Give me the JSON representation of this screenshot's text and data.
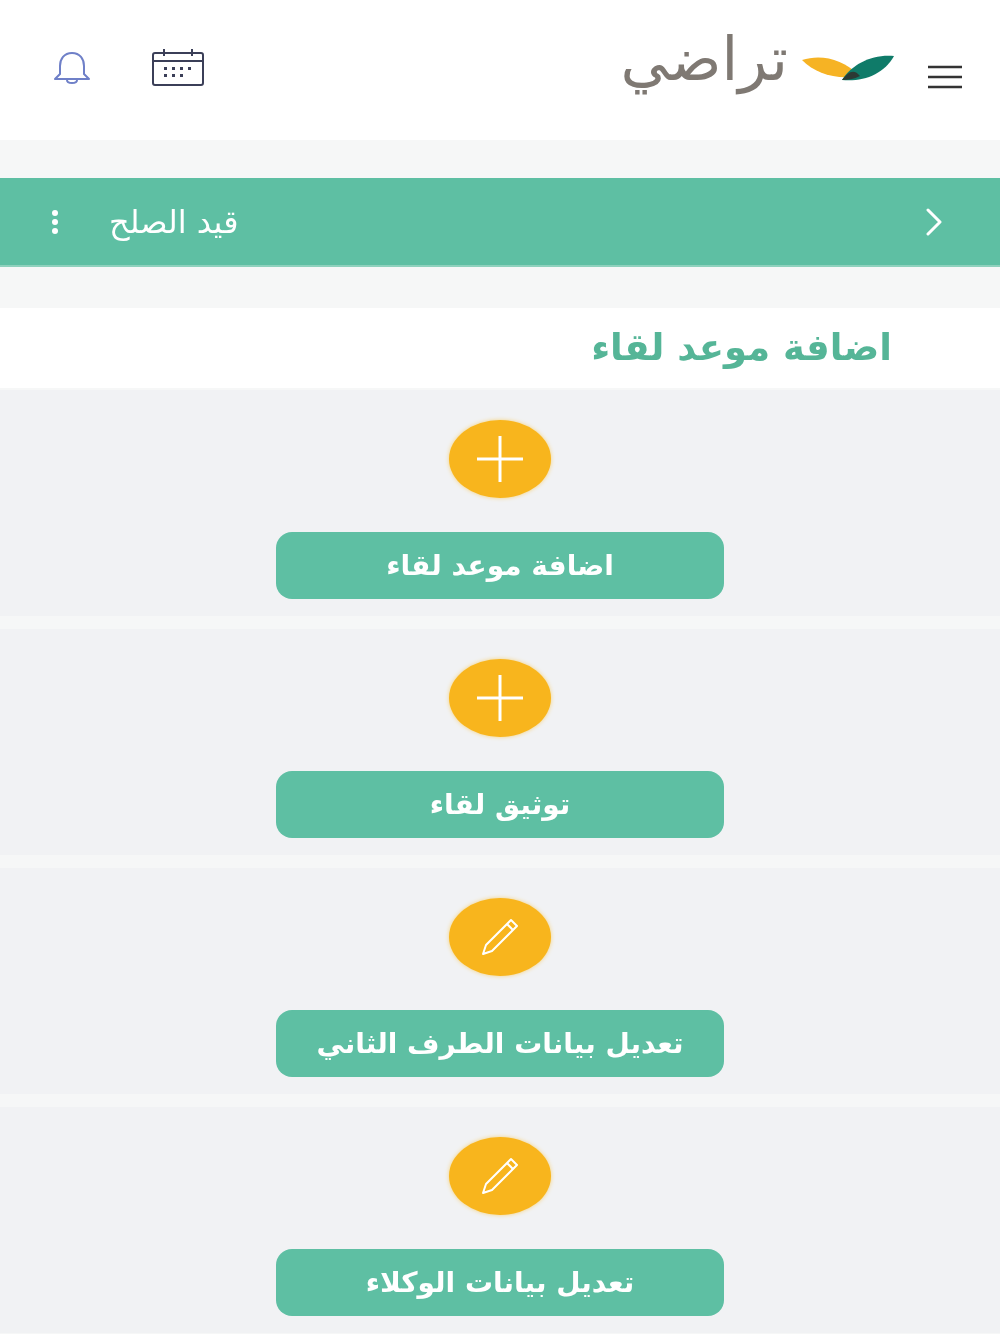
{
  "header": {
    "logo_text": "تراضي"
  },
  "title_bar": {
    "title": "قيد الصلح"
  },
  "section": {
    "heading": "اضافة موعد لقاء"
  },
  "actions": [
    {
      "kind": "add",
      "label": "اضافة موعد لقاء"
    },
    {
      "kind": "add",
      "label": "توثيق لقاء"
    },
    {
      "kind": "edit",
      "label": "تعديل بيانات الطرف الثاني"
    },
    {
      "kind": "edit",
      "label": "تعديل بيانات الوكلاء"
    }
  ]
}
